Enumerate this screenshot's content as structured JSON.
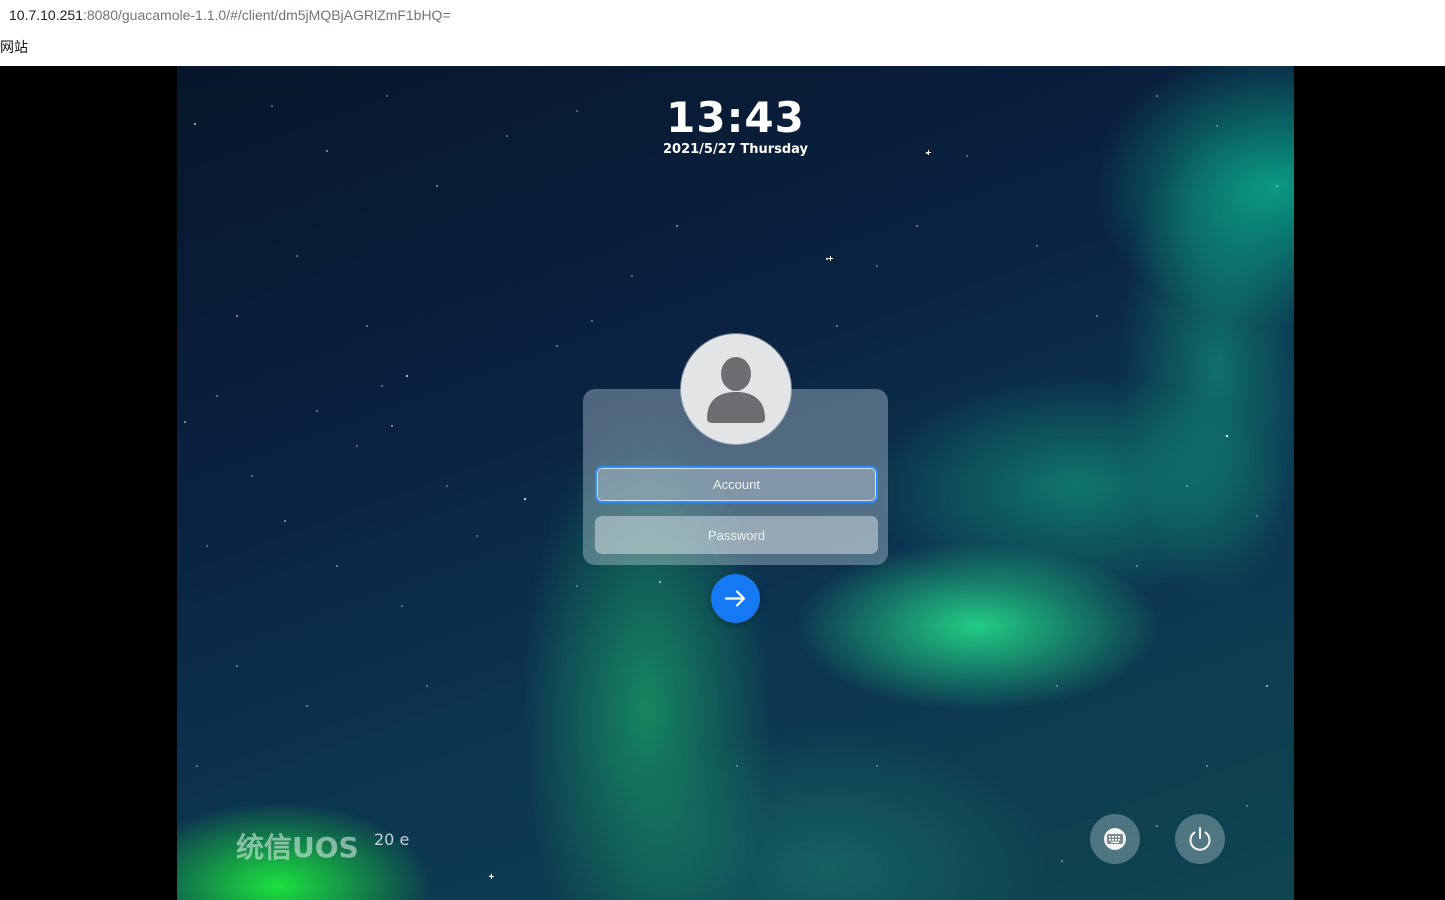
{
  "browser": {
    "url_host": "10.7.10.251",
    "url_rest": ":8080/guacamole-1.1.0/#/client/dm5jMQBjAGRlZmF1bHQ=",
    "site_label": "网站"
  },
  "lockscreen": {
    "time": "13:43",
    "date": "2021/5/27 Thursday"
  },
  "login": {
    "account_placeholder": "Account",
    "password_placeholder": "Password",
    "submit_icon": "arrow-right-icon",
    "avatar_icon": "user-silhouette-icon"
  },
  "branding": {
    "name": "统信UOS",
    "version": "20 e"
  },
  "tray": {
    "keyboard_icon": "keyboard-icon",
    "power_icon": "power-icon"
  },
  "colors": {
    "accent": "#1479f3",
    "focus_border": "#2d8cff"
  }
}
